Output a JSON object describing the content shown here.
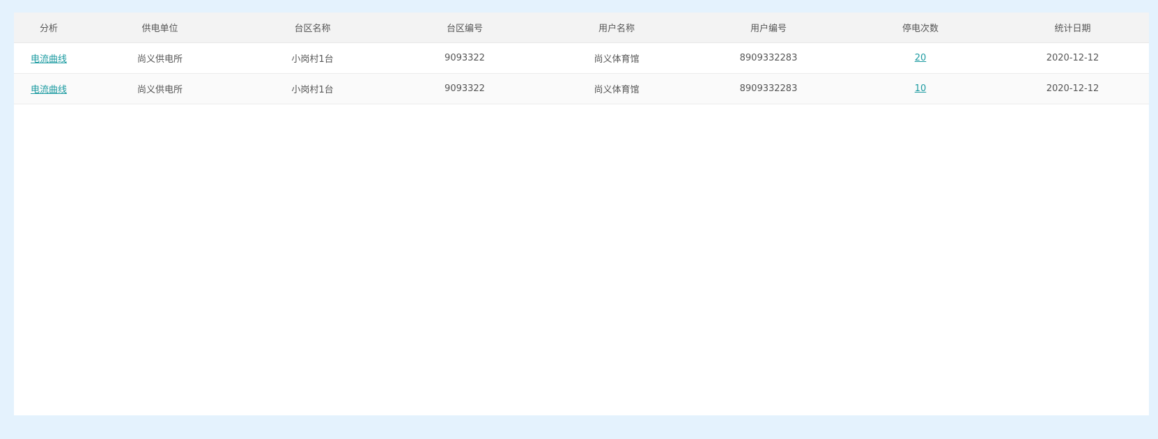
{
  "table": {
    "headers": [
      "分析",
      "供电单位",
      "台区名称",
      "台区编号",
      "用户名称",
      "用户编号",
      "停电次数",
      "统计日期"
    ],
    "rows": [
      {
        "analysis": "电流曲线",
        "supply_unit": "尚义供电所",
        "area_name": "小岗村1台",
        "area_code": "9093322",
        "user_name": "尚义体育馆",
        "user_code": "8909332283",
        "outage_count": "20",
        "stat_date": "2020-12-12"
      },
      {
        "analysis": "电流曲线",
        "supply_unit": "尚义供电所",
        "area_name": "小岗村1台",
        "area_code": "9093322",
        "user_name": "尚义体育馆",
        "user_code": "8909332283",
        "outage_count": "10",
        "stat_date": "2020-12-12"
      }
    ]
  },
  "colors": {
    "page_background": "#e4f2fd",
    "header_background": "#f3f3f3",
    "link": "#1a9aa0",
    "text": "#555555"
  }
}
